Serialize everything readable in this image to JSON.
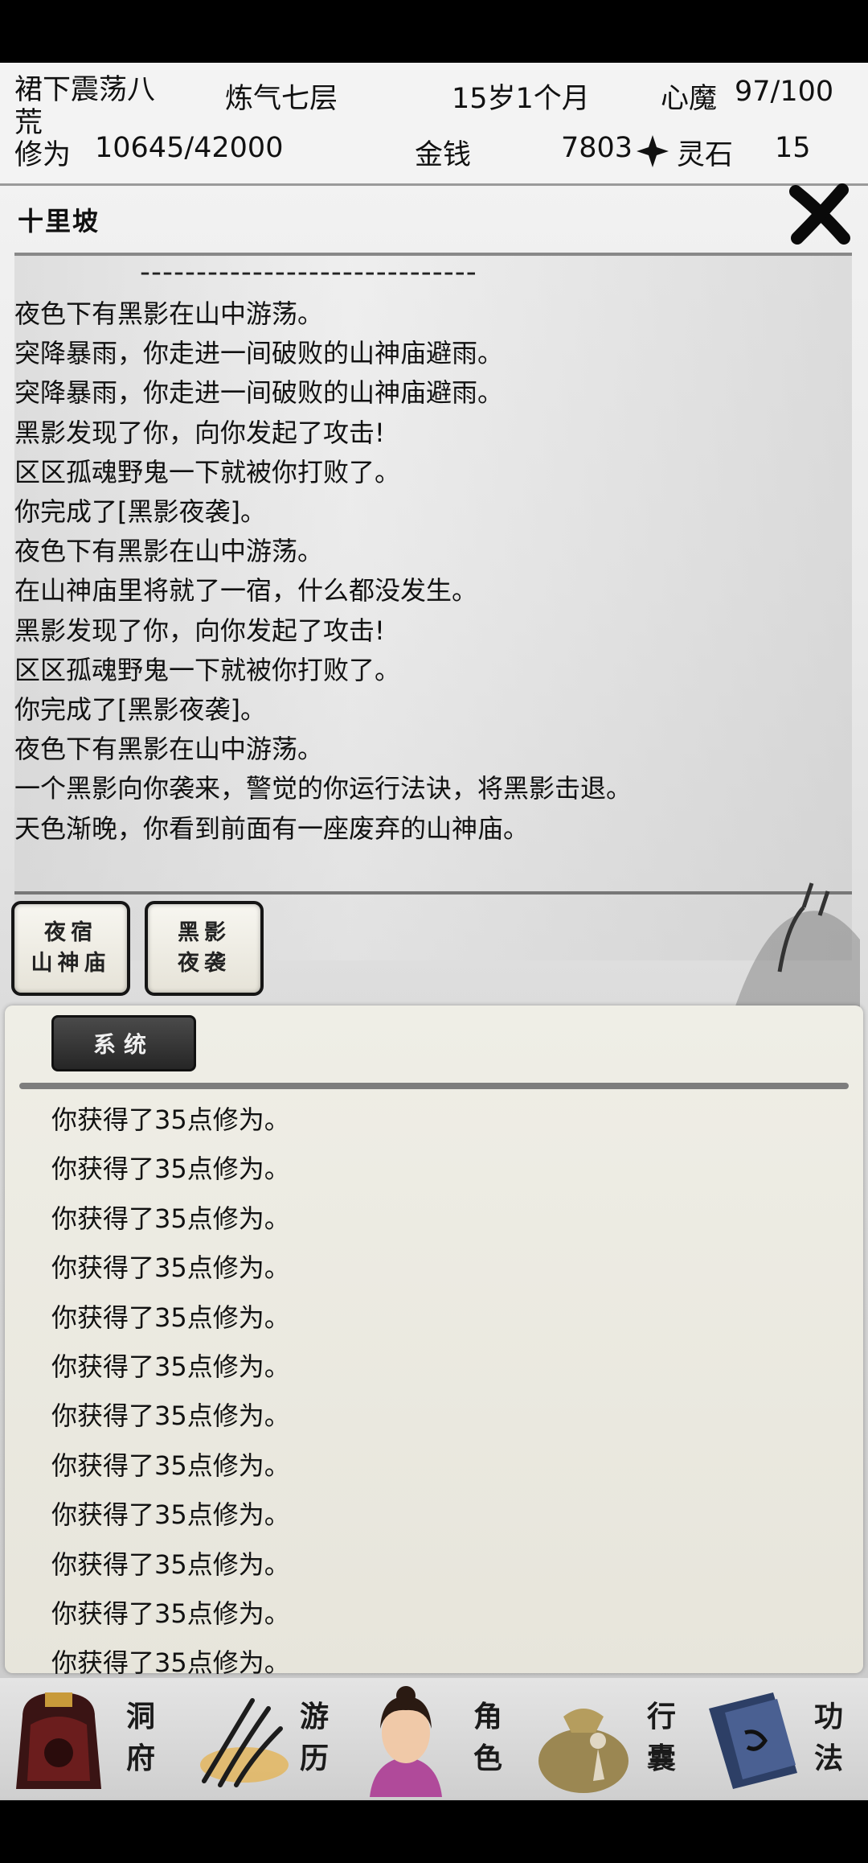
{
  "status": {
    "name": "裙下震荡八荒",
    "realm": "炼气七层",
    "age": "15岁1个月",
    "demon_label": "心魔",
    "demon_value": "97/100",
    "cultivation_label": "修为",
    "cultivation_value": "10645/42000",
    "money_label": "金钱",
    "money_value": "7803",
    "spirit_stone_label": "灵石",
    "spirit_stone_value": "15"
  },
  "location": {
    "title": "十里坡",
    "divider": "------------------------------",
    "story_lines": [
      "夜色下有黑影在山中游荡。",
      "突降暴雨，你走进一间破败的山神庙避雨。",
      "突降暴雨，你走进一间破败的山神庙避雨。",
      "黑影发现了你，向你发起了攻击!",
      "区区孤魂野鬼一下就被你打败了。",
      "你完成了[黑影夜袭]。",
      "夜色下有黑影在山中游荡。",
      "在山神庙里将就了一宿，什么都没发生。",
      "黑影发现了你，向你发起了攻击!",
      "区区孤魂野鬼一下就被你打败了。",
      "你完成了[黑影夜袭]。",
      "夜色下有黑影在山中游荡。",
      "一个黑影向你袭来，警觉的你运行法诀，将黑影击退。",
      "天色渐晚，你看到前面有一座废弃的山神庙。"
    ],
    "events": [
      {
        "line1": "夜宿",
        "line2": "山神庙"
      },
      {
        "line1": "黑影",
        "line2": "夜袭"
      }
    ]
  },
  "system_log": {
    "tab_label": "系统",
    "lines": [
      "你获得了35点修为。",
      "你获得了35点修为。",
      "你获得了35点修为。",
      "你获得了35点修为。",
      "你获得了35点修为。",
      "你获得了35点修为。",
      "你获得了35点修为。",
      "你获得了35点修为。",
      "你获得了35点修为。",
      "你获得了35点修为。",
      "你获得了35点修为。",
      "你获得了35点修为。"
    ]
  },
  "nav": {
    "items": [
      {
        "c1": "洞",
        "c2": "府",
        "icon": "cave-mansion-icon"
      },
      {
        "c1": "游",
        "c2": "历",
        "icon": "travel-icon"
      },
      {
        "c1": "角",
        "c2": "色",
        "icon": "character-icon"
      },
      {
        "c1": "行",
        "c2": "囊",
        "icon": "bag-icon"
      },
      {
        "c1": "功",
        "c2": "法",
        "icon": "skill-book-icon"
      }
    ]
  },
  "colors": {
    "top_bar": "#000000",
    "panel": "#efeee6",
    "tab_dark": "#2e2e2e"
  }
}
